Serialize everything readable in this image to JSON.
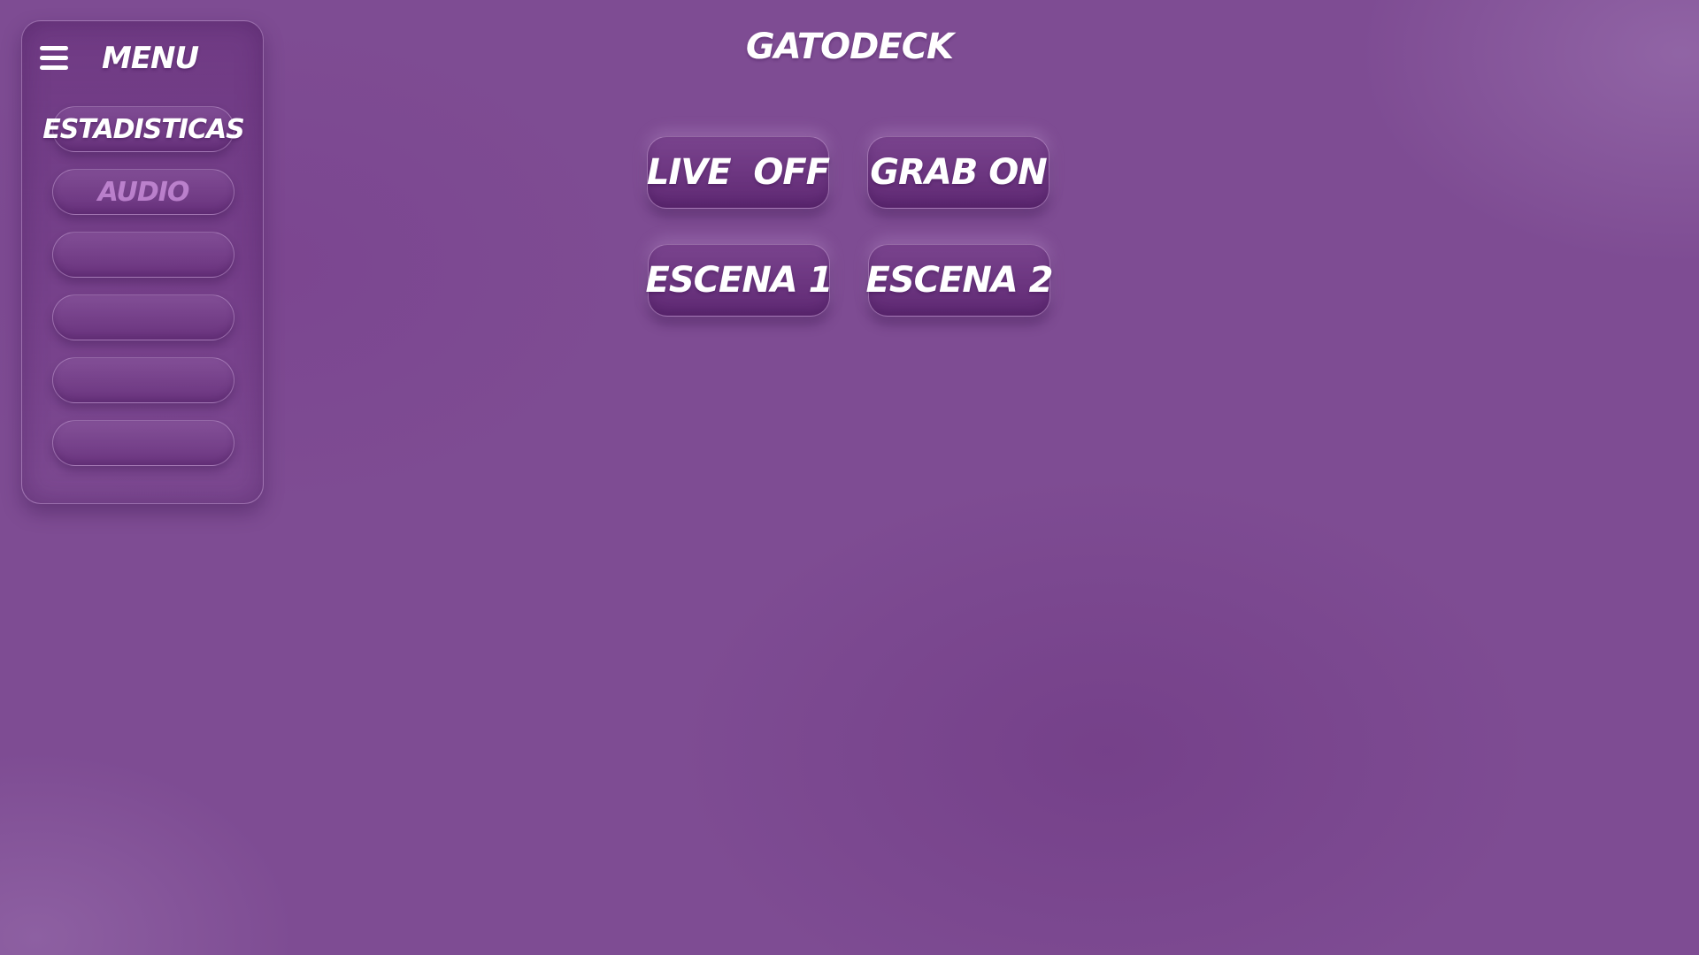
{
  "app": {
    "title": "GATODECK"
  },
  "sidebar": {
    "title": "MENU",
    "menu_icon": "hamburger-icon",
    "items": [
      {
        "label": "ESTADISTICAS",
        "state": "active"
      },
      {
        "label": "AUDIO",
        "state": "muted"
      },
      {
        "label": "",
        "state": "empty"
      },
      {
        "label": "",
        "state": "empty"
      },
      {
        "label": "",
        "state": "empty"
      },
      {
        "label": "",
        "state": "empty"
      }
    ]
  },
  "deck": {
    "buttons": [
      {
        "label": "LIVE  OFF"
      },
      {
        "label": "GRAB ON"
      },
      {
        "label": "ESCENA 1"
      },
      {
        "label": "ESCENA 2"
      }
    ]
  },
  "colors": {
    "background": "#7e4c93",
    "text": "#ffffff",
    "muted_text": "#d296e1"
  }
}
